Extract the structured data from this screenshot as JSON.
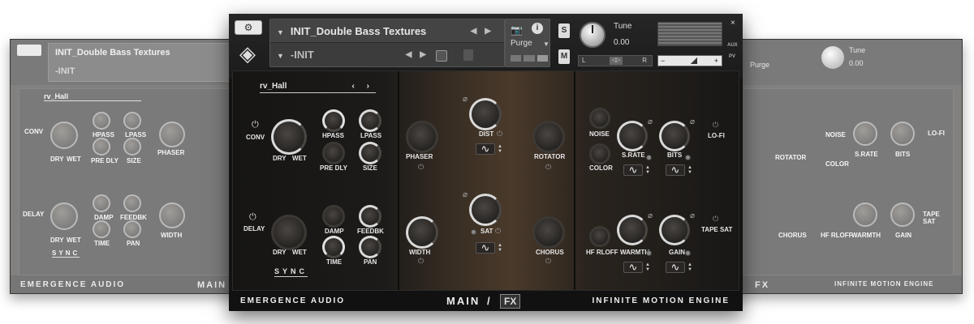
{
  "left_window": {
    "instrument": "INIT_Double Bass Textures",
    "snapshot": "-INIT",
    "reverb": "rv_Hall",
    "labels": {
      "conv": "CONV",
      "delay": "DELAY",
      "hpass": "HPASS",
      "lpass": "LPASS",
      "pre_dly": "PRE DLY",
      "size": "SIZE",
      "dry": "DRY",
      "wet": "WET",
      "damp": "DAMP",
      "feedbk": "FEEDBK",
      "time": "TIME",
      "pan": "PAN",
      "phaser": "PHASER",
      "width": "WIDTH",
      "sync": "SYNC"
    },
    "footer_left": "EMERGENCE AUDIO",
    "footer_main": "MAIN"
  },
  "right_window": {
    "purge": "Purge",
    "tune_label": "Tune",
    "tune_value": "0.00",
    "labels": {
      "rotator": "ROTATOR",
      "noise": "NOISE",
      "color": "COLOR",
      "s_rate": "S.RATE",
      "bits": "BITS",
      "lo_fi": "LO-FI",
      "chorus": "CHORUS",
      "hf_rloff": "HF RLOFF",
      "warmth": "WARMTH",
      "gain": "GAIN",
      "tape_sat": "TAPE SAT"
    },
    "footer_fx": "FX",
    "footer_right": "INFINITE MOTION ENGINE"
  },
  "header": {
    "instrument": "INIT_Double Bass Textures",
    "snapshot": "-INIT",
    "purge": "Purge",
    "solo": "S",
    "mute": "M",
    "tune_label": "Tune",
    "tune_value": "0.00",
    "pan_l": "L",
    "pan_c": "◁▷",
    "pan_r": "R",
    "vol_minus": "−",
    "vol_plus": "+",
    "close": "×",
    "aux": "AUX",
    "pv": "PV"
  },
  "reverb": {
    "preset": "rv_Hall",
    "conv": "CONV",
    "hpass": "HPASS",
    "lpass": "LPASS",
    "dry": "DRY",
    "wet": "WET",
    "pre_dly": "PRE DLY",
    "size": "SIZE"
  },
  "delay": {
    "label": "DELAY",
    "dry": "DRY",
    "wet": "WET",
    "damp": "DAMP",
    "feedbk": "FEEDBK",
    "time": "TIME",
    "pan": "PAN",
    "sync": "SYNC"
  },
  "mod": {
    "phaser": "PHASER",
    "dist": "DIST",
    "rotator": "ROTATOR",
    "sat": "SAT",
    "width": "WIDTH",
    "chorus": "CHORUS",
    "wave_glyph": "∿"
  },
  "lofi": {
    "noise": "NOISE",
    "color": "COLOR",
    "s_rate": "S.RATE",
    "bits": "BITS",
    "lo_fi": "LO-FI",
    "hf_rloff": "HF RLOFF",
    "warmth": "WARMTH",
    "gain": "GAIN",
    "tape_sat": "TAPE SAT"
  },
  "footer": {
    "brand": "EMERGENCE AUDIO",
    "main": "MAIN",
    "slash": "/",
    "fx": "FX",
    "engine": "INFINITE MOTION ENGINE"
  }
}
